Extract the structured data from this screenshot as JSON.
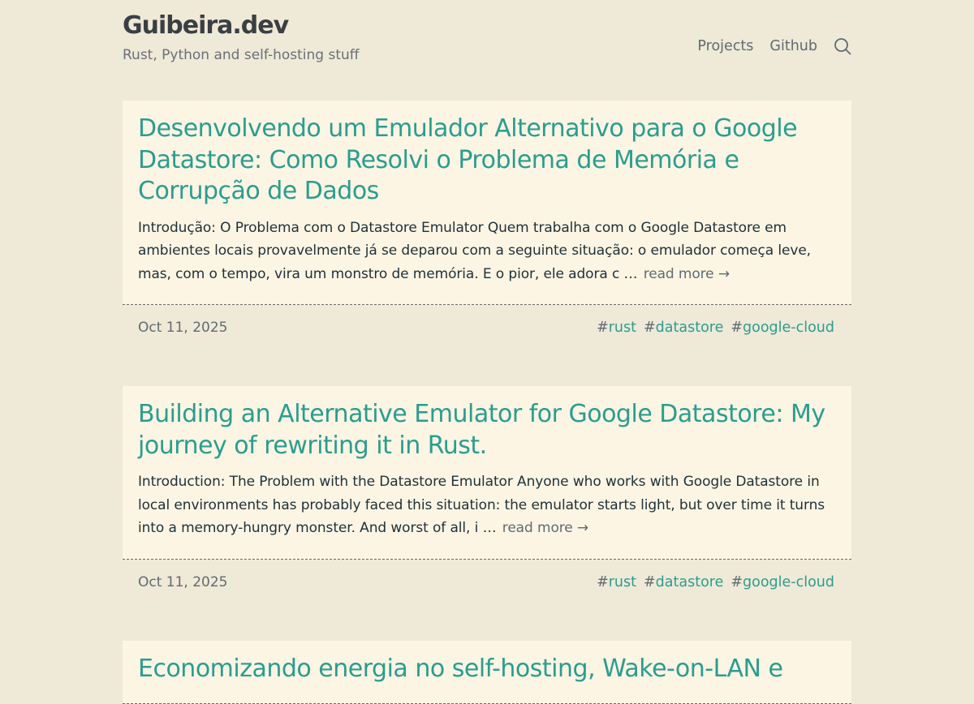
{
  "site": {
    "title": "Guibeira.dev",
    "subtitle": "Rust, Python and self-hosting stuff"
  },
  "nav": {
    "items": [
      {
        "label": "Projects"
      },
      {
        "label": "Github"
      }
    ],
    "search_icon": "search-icon"
  },
  "posts": [
    {
      "title": "Desenvolvendo um Emulador Alternativo para o Google Datastore: Como Resolvi o Problema de Memória e Corrupção de Dados",
      "excerpt": "Introdução: O Problema com o Datastore Emulator Quem trabalha com o Google Datastore em ambientes locais provavelmente já se deparou com a seguinte situação: o emulador começa leve, mas, com o tempo, vira um monstro de memória. E o pior, ele adora c …",
      "read_more": "read more →",
      "date": "Oct 11, 2025",
      "tags": [
        {
          "hash": "#",
          "name": "rust"
        },
        {
          "hash": "#",
          "name": "datastore"
        },
        {
          "hash": "#",
          "name": "google-cloud"
        }
      ]
    },
    {
      "title": "Building an Alternative Emulator for Google Datastore: My journey of rewriting it in Rust.",
      "excerpt": "Introduction: The Problem with the Datastore Emulator Anyone who works with Google Datastore in local environments has probably faced this situation: the emulator starts light, but over time it turns into a memory-hungry monster. And worst of all, i …",
      "read_more": "read more →",
      "date": "Oct 11, 2025",
      "tags": [
        {
          "hash": "#",
          "name": "rust"
        },
        {
          "hash": "#",
          "name": "datastore"
        },
        {
          "hash": "#",
          "name": "google-cloud"
        }
      ]
    },
    {
      "title": "Economizando energia no self-hosting, Wake-on-LAN e"
    }
  ],
  "colors": {
    "background": "#efe9d7",
    "card": "#fcf5e3",
    "accent": "#2a9d8f",
    "muted": "#5f6b73"
  }
}
